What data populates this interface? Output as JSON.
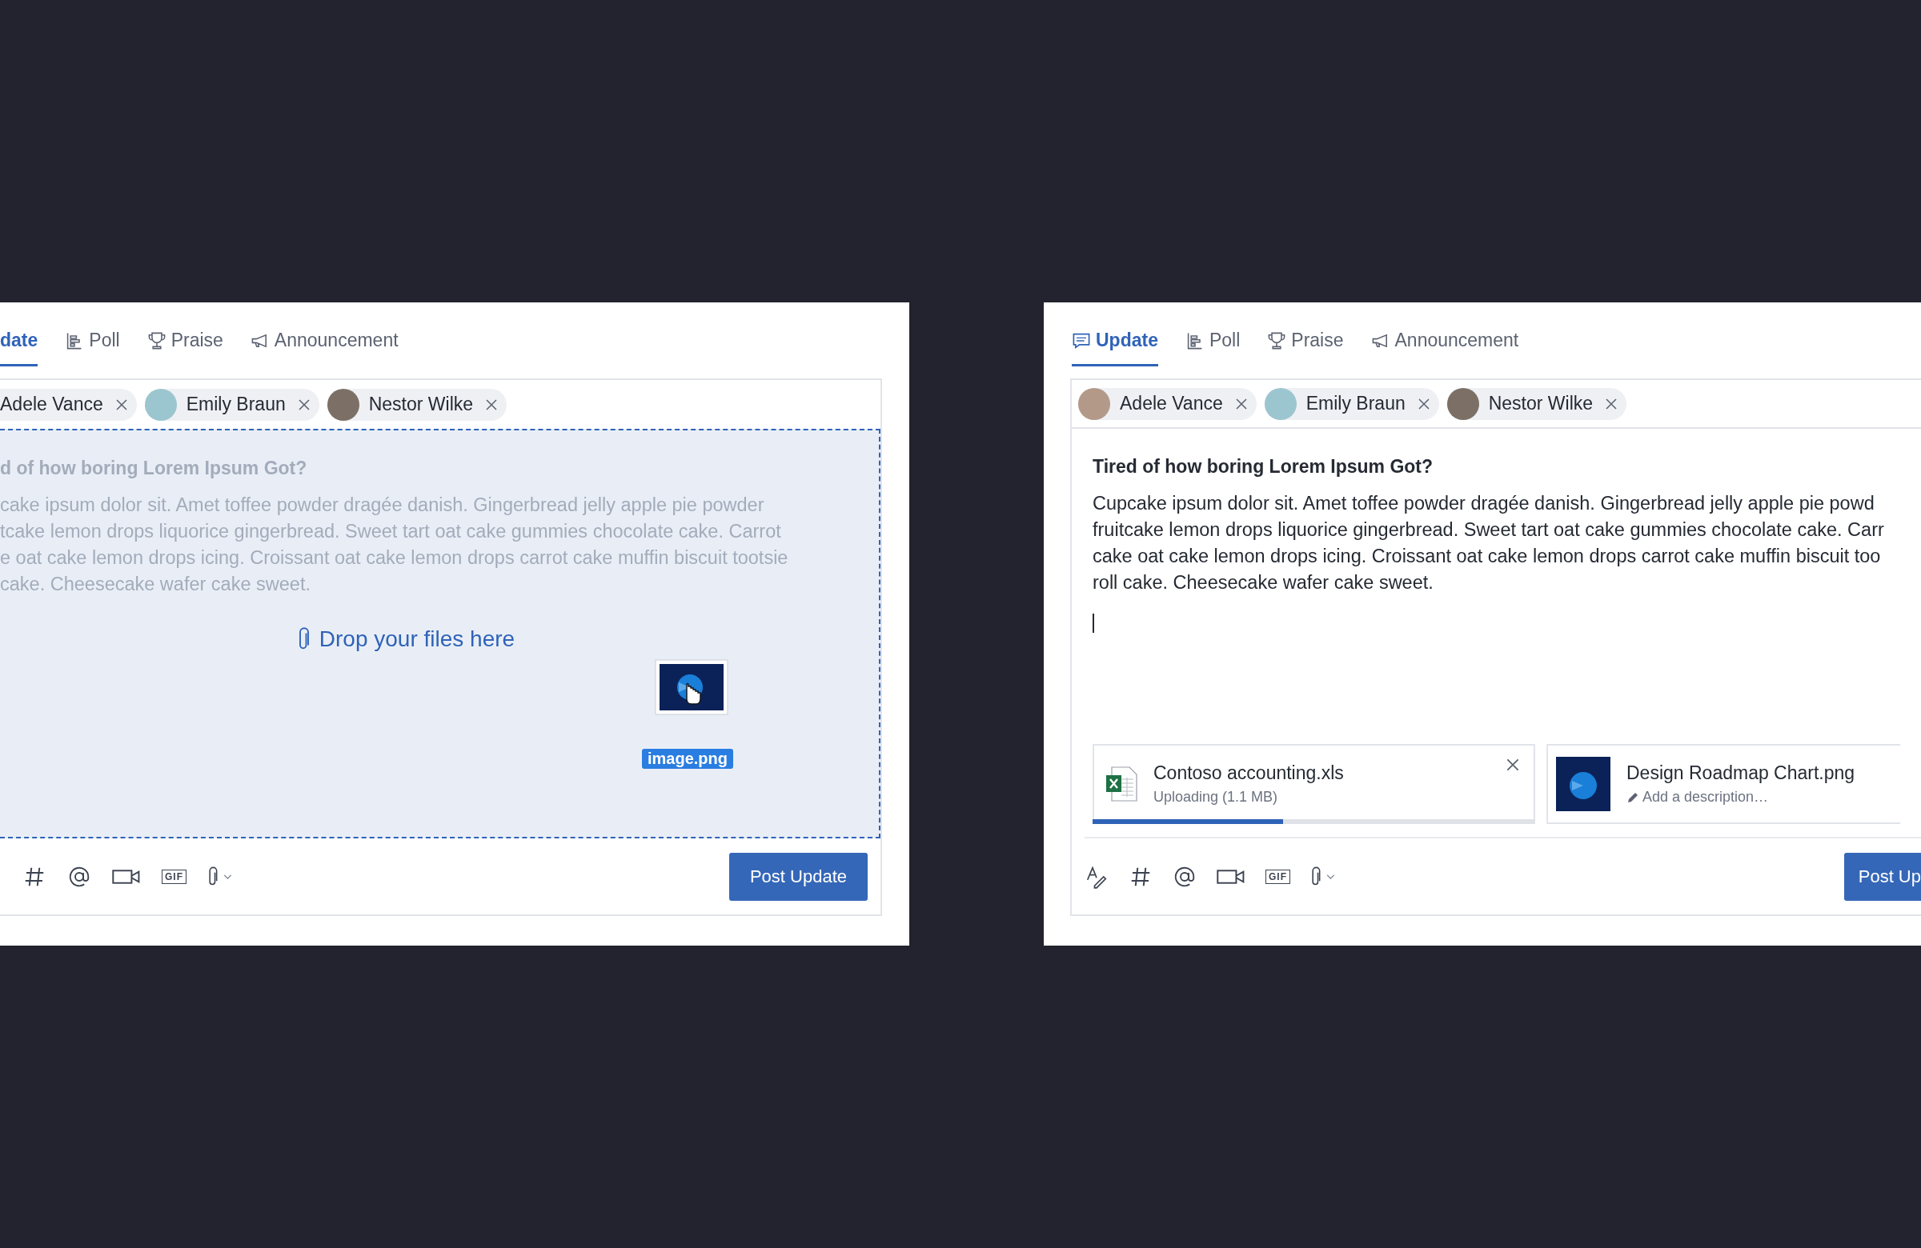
{
  "panels": [
    {
      "tabs": [
        {
          "label": "date",
          "selected": true
        },
        {
          "kind": "poll",
          "label": "Poll",
          "selected": false
        },
        {
          "kind": "praise",
          "label": "Praise",
          "selected": false
        },
        {
          "kind": "announcement",
          "label": "Announcement",
          "selected": false
        }
      ],
      "recipients": [
        {
          "name": "Adele Vance",
          "photo": false
        },
        {
          "name": "Emily Braun",
          "photo": true
        },
        {
          "name": "Nestor Wilke",
          "photo": true
        }
      ],
      "title": "d of how boring Lorem Ipsum Got?",
      "body_lines": [
        "cake ipsum dolor sit. Amet toffee powder dragée danish. Gingerbread jelly apple pie powder",
        "tcake lemon drops liquorice gingerbread. Sweet tart oat cake gummies chocolate cake. Carrot",
        "e oat cake lemon drops icing. Croissant oat cake lemon drops carrot cake muffin biscuit tootsie",
        "cake. Cheesecake wafer cake sweet."
      ],
      "drop_zone": {
        "label": "Drop your files here",
        "dragged_file": "image.png"
      },
      "tools": [
        {
          "kind": "hashtag"
        },
        {
          "kind": "mention"
        },
        {
          "kind": "video"
        },
        {
          "kind": "gif",
          "label": "GIF"
        },
        {
          "kind": "attach"
        }
      ],
      "post_button": "Post Update"
    },
    {
      "tabs": [
        {
          "kind": "update",
          "label": "Update",
          "selected": true
        },
        {
          "kind": "poll",
          "label": "Poll",
          "selected": false
        },
        {
          "kind": "praise",
          "label": "Praise",
          "selected": false
        },
        {
          "kind": "announcement",
          "label": "Announcement",
          "selected": false
        }
      ],
      "recipients": [
        {
          "name": "Adele Vance",
          "photo": true
        },
        {
          "name": "Emily Braun",
          "photo": true
        },
        {
          "name": "Nestor Wilke",
          "photo": true
        }
      ],
      "title": "Tired of how boring Lorem Ipsum Got?",
      "body_lines": [
        "Cupcake ipsum dolor sit. Amet toffee powder dragée danish. Gingerbread jelly apple pie powd",
        "fruitcake lemon drops liquorice gingerbread. Sweet tart oat cake gummies chocolate cake. Carr",
        "cake oat cake lemon drops icing. Croissant oat cake lemon drops carrot cake muffin biscuit too",
        "roll cake. Cheesecake wafer cake sweet."
      ],
      "cursor": true,
      "attachments": [
        {
          "kind": "spreadsheet",
          "name": "Contoso accounting.xls",
          "status": "Uploading (1.1 MB)",
          "level": 0.43,
          "removable": true
        },
        {
          "kind": "image",
          "name": "Design Roadmap Chart.png",
          "placeholder": "Add a description…"
        }
      ],
      "tools": [
        {
          "kind": "format"
        },
        {
          "kind": "hashtag"
        },
        {
          "kind": "mention"
        },
        {
          "kind": "video"
        },
        {
          "kind": "gif",
          "label": "GIF"
        },
        {
          "kind": "attach"
        }
      ],
      "post_button": "Post Up"
    }
  ]
}
